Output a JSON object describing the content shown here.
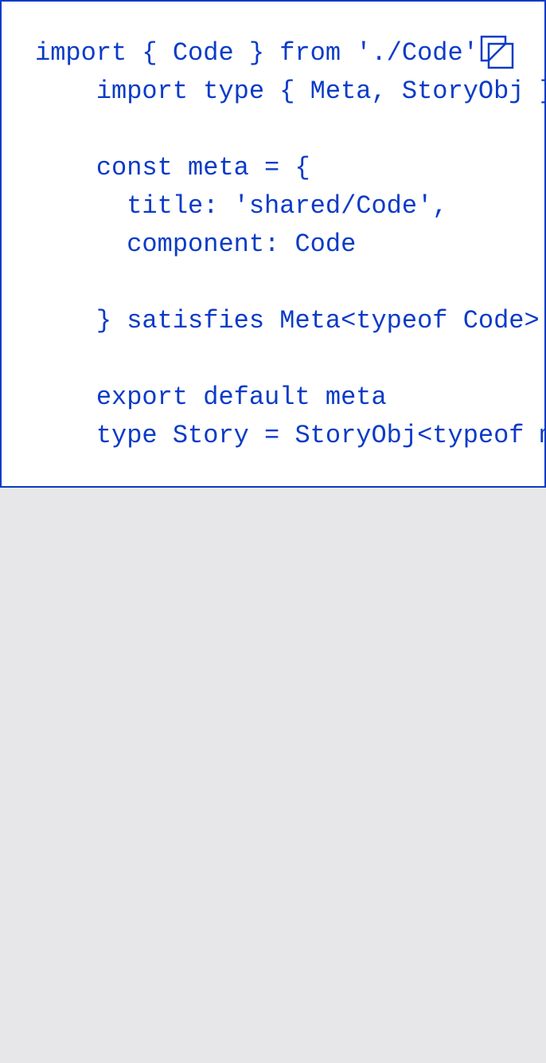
{
  "code_block": {
    "lines": [
      "import { Code } from './Code'",
      "    import type { Meta, StoryObj } from '@storybook/react'",
      "",
      "    const meta = {",
      "      title: 'shared/Code',",
      "      component: Code",
      "",
      "    } satisfies Meta<typeof Code>",
      "",
      "    export default meta",
      "    type Story = StoryObj<typeof meta>"
    ]
  },
  "icons": {
    "copy": "copy-icon"
  },
  "colors": {
    "code_text": "#0b3bc7",
    "border": "#0b3bc7",
    "card_background": "#ffffff",
    "page_background": "#e7e7e9"
  }
}
